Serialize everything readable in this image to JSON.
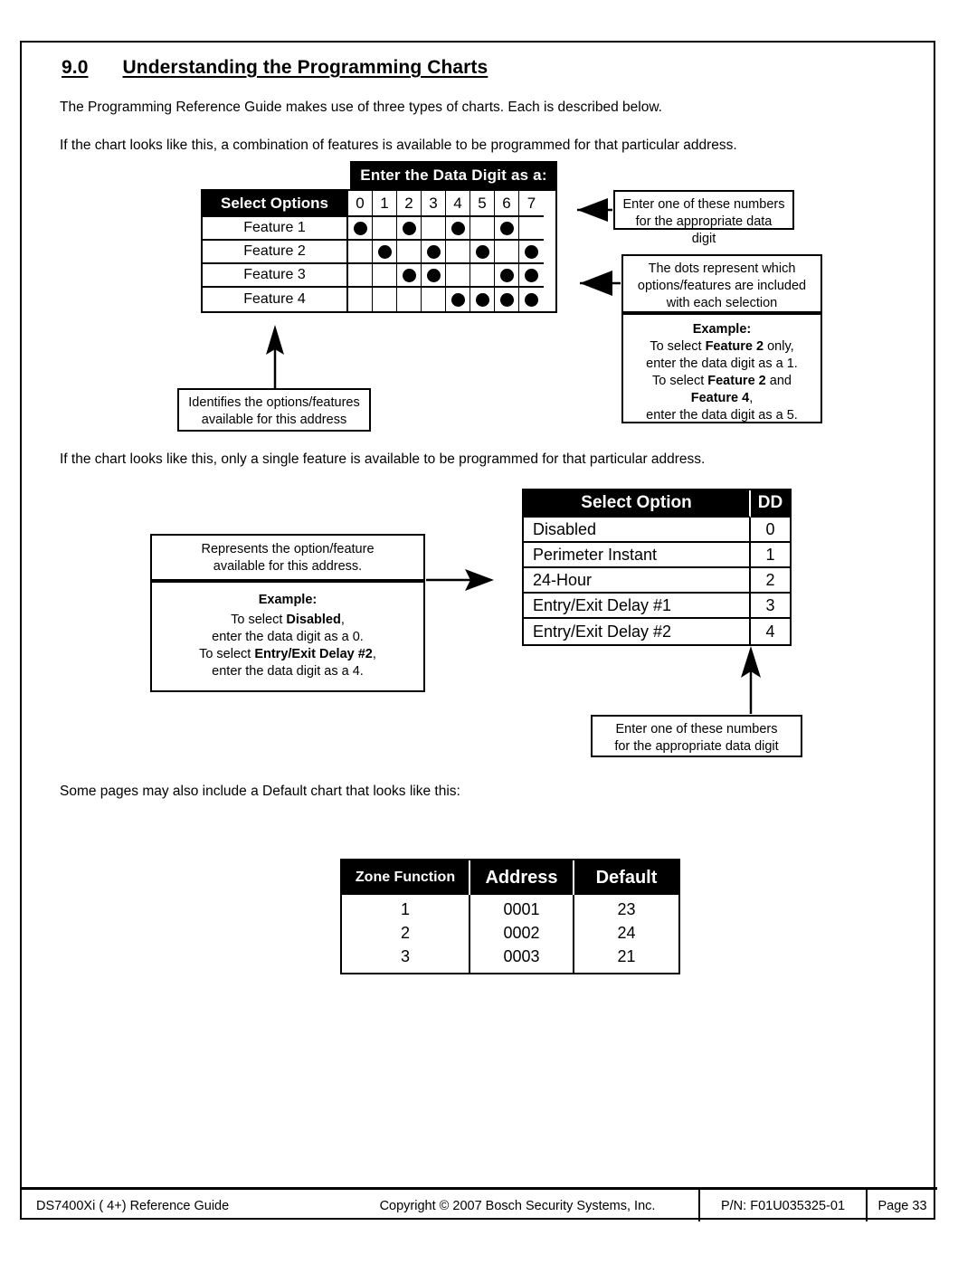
{
  "heading": {
    "number": "9.0",
    "title": "Understanding the Programming Charts"
  },
  "paragraphs": {
    "intro": "The Programming Reference Guide makes use of three types of charts. Each is described below.",
    "combo_chart": "If the chart looks like this, a combination of features is available to be programmed for that particular address.",
    "single_chart": "If the chart looks like this, only a single feature is available to be programmed for that particular address.",
    "default_chart": "Some pages may also include a Default chart that looks like this:"
  },
  "chart_data": [
    {
      "type": "table",
      "name": "feature-matrix-chart",
      "title": "Enter the Data Digit as a:",
      "row_header": "Select Options",
      "columns": [
        "0",
        "1",
        "2",
        "3",
        "4",
        "5",
        "6",
        "7"
      ],
      "rows": [
        {
          "label": "Feature 1",
          "dots": [
            true,
            false,
            true,
            false,
            true,
            false,
            true,
            false
          ]
        },
        {
          "label": "Feature 2",
          "dots": [
            false,
            true,
            false,
            true,
            false,
            true,
            false,
            true
          ]
        },
        {
          "label": "Feature 3",
          "dots": [
            false,
            false,
            true,
            true,
            false,
            false,
            true,
            true
          ]
        },
        {
          "label": "Feature 4",
          "dots": [
            false,
            false,
            false,
            false,
            true,
            true,
            true,
            true
          ]
        }
      ]
    },
    {
      "type": "table",
      "name": "single-option-chart",
      "headers": [
        "Select Option",
        "DD"
      ],
      "rows": [
        {
          "option": "Disabled",
          "dd": "0"
        },
        {
          "option": "Perimeter Instant",
          "dd": "1"
        },
        {
          "option": "24-Hour",
          "dd": "2"
        },
        {
          "option": "Entry/Exit Delay #1",
          "dd": "3"
        },
        {
          "option": "Entry/Exit Delay #2",
          "dd": "4"
        }
      ]
    },
    {
      "type": "table",
      "name": "default-chart",
      "headers": [
        "Zone Function",
        "Address",
        "Default"
      ],
      "rows": [
        {
          "zone_function": "1",
          "address": "0001",
          "default": "23"
        },
        {
          "zone_function": "2",
          "address": "0002",
          "default": "24"
        },
        {
          "zone_function": "3",
          "address": "0003",
          "default": "21"
        }
      ]
    }
  ],
  "callouts": {
    "digits_top": {
      "line1": "Enter one of these numbers",
      "line2": "for the appropriate data digit"
    },
    "dots_meaning": {
      "line1": "The dots represent which",
      "line2": "options/features are included",
      "line3": "with each selection"
    },
    "example1": {
      "title": "Example:",
      "l1a": "To select ",
      "l1b": "Feature 2",
      "l1c": " only,",
      "l2": "enter the data digit as a 1.",
      "l3a": "To select ",
      "l3b": "Feature 2",
      "l3c": " and",
      "l4b": "Feature 4",
      "l4c": ",",
      "l5": "enter the data digit as a 5."
    },
    "identifies": {
      "line1": "Identifies the options/features",
      "line2": "available for this address"
    },
    "represents": {
      "line1": "Represents the option/feature",
      "line2": "available for this address."
    },
    "example2": {
      "title": "Example:",
      "l1a": "To select ",
      "l1b": "Disabled",
      "l1c": ",",
      "l2": "enter the data digit as a 0.",
      "l3a": "To select ",
      "l3b": "Entry/Exit Delay #2",
      "l3c": ",",
      "l4": "enter the data digit as a 4."
    },
    "digits_bottom": {
      "line1": "Enter one of these numbers",
      "line2": "for the appropriate data digit"
    }
  },
  "footer": {
    "guide": "DS7400Xi ( 4+) Reference Guide",
    "copyright": "Copyright © 2007 Bosch Security Systems, Inc.",
    "part_number": "P/N: F01U035325-01",
    "page": "Page 33"
  },
  "colors": {
    "ink": "#000000",
    "paper": "#ffffff"
  }
}
